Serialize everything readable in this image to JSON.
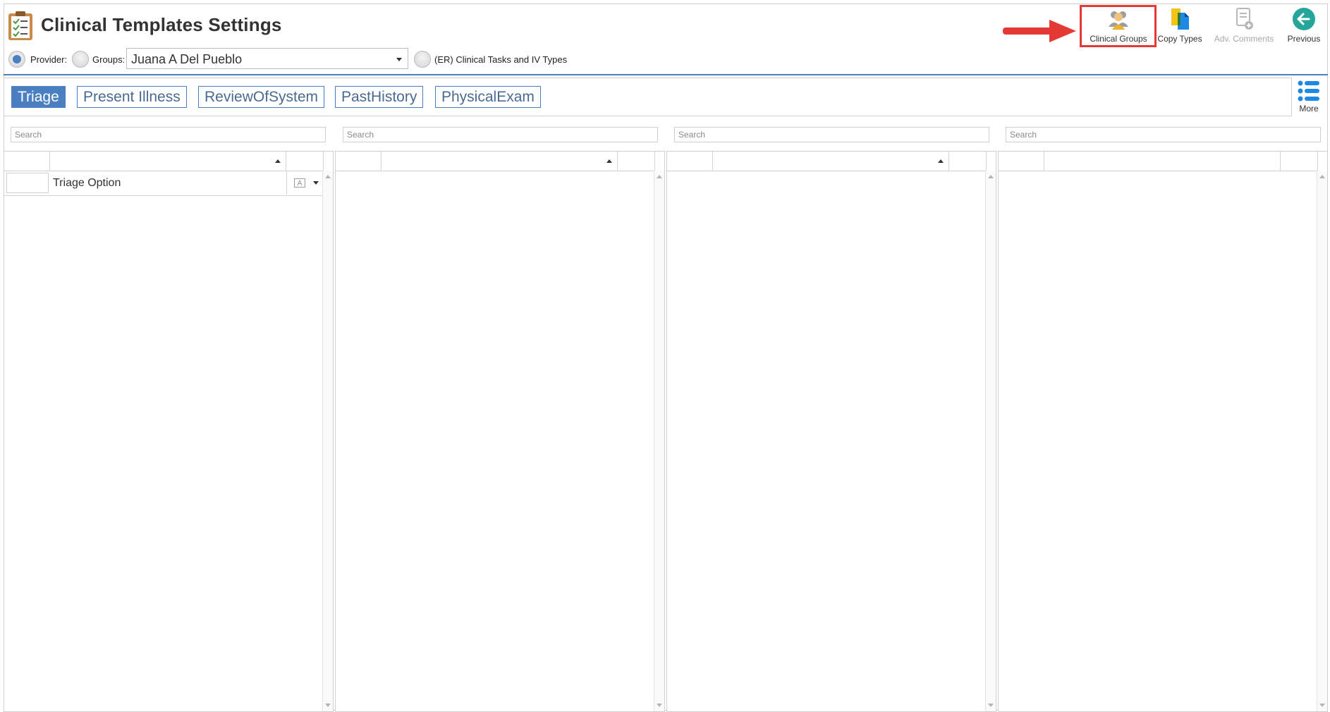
{
  "header": {
    "title": "Clinical Templates Settings",
    "provider_label": "Provider:",
    "groups_label": "Groups:",
    "selected_group": "Juana A Del Pueblo",
    "er_label": "(ER) Clinical Tasks and IV Types"
  },
  "toolbar": {
    "clinical_groups": "Clinical Groups",
    "copy_types": "Copy Types",
    "adv_comments": "Adv. Comments",
    "previous": "Previous"
  },
  "tabs": [
    {
      "label": "Triage",
      "active": true
    },
    {
      "label": "Present Illness",
      "active": false
    },
    {
      "label": "ReviewOfSystem",
      "active": false
    },
    {
      "label": "PastHistory",
      "active": false
    },
    {
      "label": "PhysicalExam",
      "active": false
    }
  ],
  "more_label": "More",
  "search_placeholder": "Search",
  "grids": [
    {
      "rows": [
        {
          "text": "Triage Option"
        }
      ]
    },
    {
      "rows": []
    },
    {
      "rows": []
    },
    {
      "rows": []
    }
  ],
  "colors": {
    "accent": "#4a7fc1",
    "highlight": "#e53935"
  }
}
